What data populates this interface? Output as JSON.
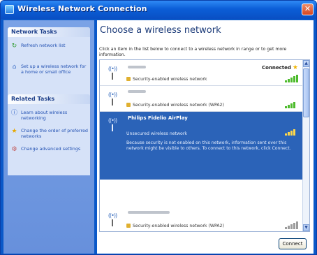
{
  "window": {
    "title": "Wireless Network Connection",
    "close_glyph": "✕"
  },
  "sidebar": {
    "network_tasks": {
      "header": "Network Tasks",
      "items": [
        {
          "icon": "refresh-icon",
          "label": "Refresh network list"
        },
        {
          "icon": "wireless-setup-icon",
          "label": "Set up a wireless network for a home or small office"
        }
      ]
    },
    "related_tasks": {
      "header": "Related Tasks",
      "items": [
        {
          "icon": "info-icon",
          "label": "Learn about wireless networking"
        },
        {
          "icon": "star-icon",
          "label": "Change the order of preferred networks"
        },
        {
          "icon": "settings-icon",
          "label": "Change advanced settings"
        }
      ]
    }
  },
  "main": {
    "heading": "Choose a wireless network",
    "intro": "Click an item in the list below to connect to a wireless network in range or to get more information.",
    "networks": [
      {
        "name": "",
        "security": "Security-enabled wireless network",
        "status": "Connected",
        "icon": "wireless-antenna-icon",
        "signal": 5
      },
      {
        "name": "",
        "security": "Security-enabled wireless network (WPA2)",
        "status": "",
        "icon": "wireless-antenna-icon",
        "signal": 4
      },
      {
        "name": "Philips Fidelio AirPlay",
        "security": "Unsecured wireless network",
        "status": "",
        "icon": "wireless-antenna-icon",
        "signal": 4,
        "warning": "Because security is not enabled on this network, information sent over this network might be visible to others. To connect to this network, click Connect."
      },
      {
        "name": "",
        "security": "Security-enabled wireless network (WPA2)",
        "status": "",
        "icon": "wireless-antenna-icon",
        "signal": 2
      },
      {
        "name": "",
        "security": "",
        "status": "",
        "icon": "wireless-antenna-icon",
        "signal": 0
      }
    ],
    "connect_label": "Connect"
  },
  "colors": {
    "title_bar": "#0b5ed7",
    "sidebar": "#6f98e0",
    "selection": "#2b63b8",
    "signal": "#4dbb2c"
  }
}
